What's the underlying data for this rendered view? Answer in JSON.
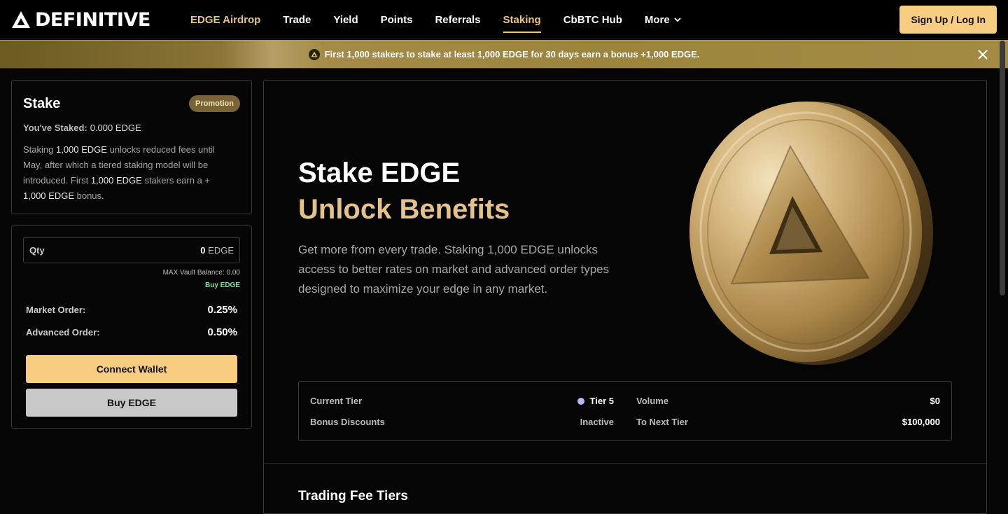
{
  "brand": {
    "name": "DEFINITIVE"
  },
  "nav": {
    "links": [
      {
        "label": "EDGE Airdrop"
      },
      {
        "label": "Trade"
      },
      {
        "label": "Yield"
      },
      {
        "label": "Points"
      },
      {
        "label": "Referrals"
      },
      {
        "label": "Staking"
      },
      {
        "label": "CbBTC Hub"
      },
      {
        "label": "More"
      }
    ],
    "signup_label": "Sign Up / Log In"
  },
  "banner": {
    "text": "First 1,000 stakers to stake at least 1,000 EDGE for 30 days earn a bonus +1,000 EDGE."
  },
  "stake_card": {
    "title": "Stake",
    "badge": "Promotion",
    "staked_label": "You've Staked:",
    "staked_value": "0.000 EDGE",
    "desc_parts": [
      "Staking ",
      "1,000 EDGE",
      " unlocks reduced fees until May, after which a tiered staking model will be introduced. First ",
      "1,000 EDGE",
      " stakers earn a + ",
      "1,000 EDGE",
      " bonus."
    ]
  },
  "order_card": {
    "qty_label": "Qty",
    "qty_amount": "0",
    "qty_unit": "EDGE",
    "max_balance": "MAX Vault Balance: 0.00",
    "buy_link": "Buy EDGE",
    "market_label": "Market Order:",
    "market_value": "0.25%",
    "advanced_label": "Advanced Order:",
    "advanced_value": "0.50%",
    "connect_label": "Connect Wallet",
    "buy_label": "Buy EDGE"
  },
  "hero": {
    "title_line1": "Stake EDGE",
    "title_line2": "Unlock Benefits",
    "description": "Get more from every trade. Staking 1,000 EDGE unlocks access to better rates on market and advanced order types designed to maximize your edge in any market."
  },
  "tier": {
    "current_tier_label": "Current Tier",
    "current_tier_value": "Tier 5",
    "bonus_label": "Bonus Discounts",
    "bonus_value": "Inactive",
    "volume_label": "Volume",
    "volume_value": "$0",
    "next_tier_label": "To Next Tier",
    "next_tier_value": "$100,000"
  },
  "fee_tiers": {
    "title": "Trading Fee Tiers"
  },
  "colors": {
    "accent": "#f7cd82",
    "gold_text": "#e4c28c",
    "buy_link": "#7ee39a",
    "tier_dot": "#b7b9f4"
  },
  "icons": [
    "logo-triangle-icon",
    "chevron-down-icon",
    "edge-token-icon",
    "close-icon"
  ]
}
